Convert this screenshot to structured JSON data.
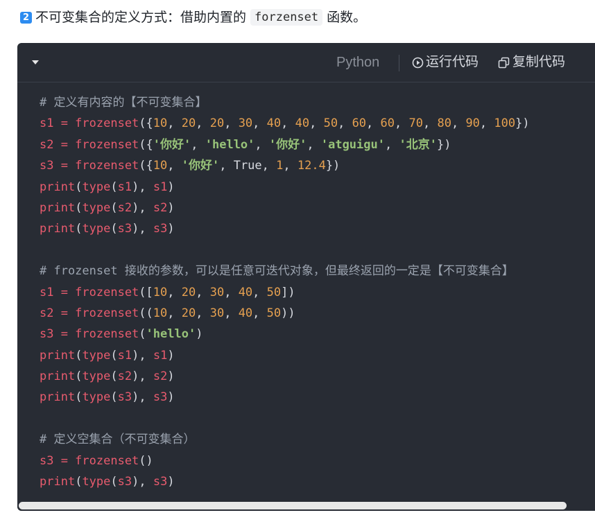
{
  "heading": {
    "badge": "2",
    "text_before": "不可变集合的定义方式：借助内置的",
    "code": "forzenset",
    "text_after": "函数。"
  },
  "toolbar": {
    "language": "Python",
    "run_label": "运行代码",
    "copy_label": "复制代码",
    "collapse_icon": "caret-down-icon",
    "run_icon": "play-circle-icon",
    "copy_icon": "copy-icon"
  },
  "colors": {
    "code_bg": "#282c34",
    "comment": "#9ba3af",
    "identifier": "#e85b6e",
    "number": "#e5a050",
    "string": "#98c379",
    "badge": "#2d8cf0"
  },
  "code_lines": [
    [
      [
        "c",
        "# 定义有内容的【不可变集合】"
      ]
    ],
    [
      [
        "r",
        "s1 = frozenset"
      ],
      [
        "p",
        "({"
      ],
      [
        "o",
        "10"
      ],
      [
        "p",
        ", "
      ],
      [
        "o",
        "20"
      ],
      [
        "p",
        ", "
      ],
      [
        "o",
        "20"
      ],
      [
        "p",
        ", "
      ],
      [
        "o",
        "30"
      ],
      [
        "p",
        ", "
      ],
      [
        "o",
        "40"
      ],
      [
        "p",
        ", "
      ],
      [
        "o",
        "40"
      ],
      [
        "p",
        ", "
      ],
      [
        "o",
        "50"
      ],
      [
        "p",
        ", "
      ],
      [
        "o",
        "60"
      ],
      [
        "p",
        ", "
      ],
      [
        "o",
        "60"
      ],
      [
        "p",
        ", "
      ],
      [
        "o",
        "70"
      ],
      [
        "p",
        ", "
      ],
      [
        "o",
        "80"
      ],
      [
        "p",
        ", "
      ],
      [
        "o",
        "90"
      ],
      [
        "p",
        ", "
      ],
      [
        "o",
        "100"
      ],
      [
        "p",
        "})"
      ]
    ],
    [
      [
        "r",
        "s2 = frozenset"
      ],
      [
        "p",
        "({"
      ],
      [
        "g",
        "'你好'"
      ],
      [
        "p",
        ", "
      ],
      [
        "g",
        "'hello'"
      ],
      [
        "p",
        ", "
      ],
      [
        "g",
        "'你好'"
      ],
      [
        "p",
        ", "
      ],
      [
        "g",
        "'atguigu'"
      ],
      [
        "p",
        ", "
      ],
      [
        "g",
        "'北京'"
      ],
      [
        "p",
        "})"
      ]
    ],
    [
      [
        "r",
        "s3 = frozenset"
      ],
      [
        "p",
        "({"
      ],
      [
        "o",
        "10"
      ],
      [
        "p",
        ", "
      ],
      [
        "g",
        "'你好'"
      ],
      [
        "p",
        ", True, "
      ],
      [
        "o",
        "1"
      ],
      [
        "p",
        ", "
      ],
      [
        "o",
        "12.4"
      ],
      [
        "p",
        "})"
      ]
    ],
    [
      [
        "r",
        "print"
      ],
      [
        "p",
        "("
      ],
      [
        "r",
        "type"
      ],
      [
        "p",
        "("
      ],
      [
        "r",
        "s1"
      ],
      [
        "p",
        "), "
      ],
      [
        "r",
        "s1"
      ],
      [
        "p",
        ")"
      ]
    ],
    [
      [
        "r",
        "print"
      ],
      [
        "p",
        "("
      ],
      [
        "r",
        "type"
      ],
      [
        "p",
        "("
      ],
      [
        "r",
        "s2"
      ],
      [
        "p",
        "), "
      ],
      [
        "r",
        "s2"
      ],
      [
        "p",
        ")"
      ]
    ],
    [
      [
        "r",
        "print"
      ],
      [
        "p",
        "("
      ],
      [
        "r",
        "type"
      ],
      [
        "p",
        "("
      ],
      [
        "r",
        "s3"
      ],
      [
        "p",
        "), "
      ],
      [
        "r",
        "s3"
      ],
      [
        "p",
        ")"
      ]
    ],
    [],
    [
      [
        "c",
        "# frozenset 接收的参数，可以是任意可迭代对象，但最终返回的一定是【不可变集合】"
      ]
    ],
    [
      [
        "r",
        "s1 = frozenset"
      ],
      [
        "p",
        "(["
      ],
      [
        "o",
        "10"
      ],
      [
        "p",
        ", "
      ],
      [
        "o",
        "20"
      ],
      [
        "p",
        ", "
      ],
      [
        "o",
        "30"
      ],
      [
        "p",
        ", "
      ],
      [
        "o",
        "40"
      ],
      [
        "p",
        ", "
      ],
      [
        "o",
        "50"
      ],
      [
        "p",
        "])"
      ]
    ],
    [
      [
        "r",
        "s2 = frozenset"
      ],
      [
        "p",
        "(("
      ],
      [
        "o",
        "10"
      ],
      [
        "p",
        ", "
      ],
      [
        "o",
        "20"
      ],
      [
        "p",
        ", "
      ],
      [
        "o",
        "30"
      ],
      [
        "p",
        ", "
      ],
      [
        "o",
        "40"
      ],
      [
        "p",
        ", "
      ],
      [
        "o",
        "50"
      ],
      [
        "p",
        "))"
      ]
    ],
    [
      [
        "r",
        "s3 = frozenset"
      ],
      [
        "p",
        "("
      ],
      [
        "g",
        "'hello'"
      ],
      [
        "p",
        ")"
      ]
    ],
    [
      [
        "r",
        "print"
      ],
      [
        "p",
        "("
      ],
      [
        "r",
        "type"
      ],
      [
        "p",
        "("
      ],
      [
        "r",
        "s1"
      ],
      [
        "p",
        "), "
      ],
      [
        "r",
        "s1"
      ],
      [
        "p",
        ")"
      ]
    ],
    [
      [
        "r",
        "print"
      ],
      [
        "p",
        "("
      ],
      [
        "r",
        "type"
      ],
      [
        "p",
        "("
      ],
      [
        "r",
        "s2"
      ],
      [
        "p",
        "), "
      ],
      [
        "r",
        "s2"
      ],
      [
        "p",
        ")"
      ]
    ],
    [
      [
        "r",
        "print"
      ],
      [
        "p",
        "("
      ],
      [
        "r",
        "type"
      ],
      [
        "p",
        "("
      ],
      [
        "r",
        "s3"
      ],
      [
        "p",
        "), "
      ],
      [
        "r",
        "s3"
      ],
      [
        "p",
        ")"
      ]
    ],
    [],
    [
      [
        "c",
        "# 定义空集合（不可变集合）"
      ]
    ],
    [
      [
        "r",
        "s3 = frozenset"
      ],
      [
        "p",
        "()"
      ]
    ],
    [
      [
        "r",
        "print"
      ],
      [
        "p",
        "("
      ],
      [
        "r",
        "type"
      ],
      [
        "p",
        "("
      ],
      [
        "r",
        "s3"
      ],
      [
        "p",
        "), "
      ],
      [
        "r",
        "s3"
      ],
      [
        "p",
        ")"
      ]
    ]
  ]
}
